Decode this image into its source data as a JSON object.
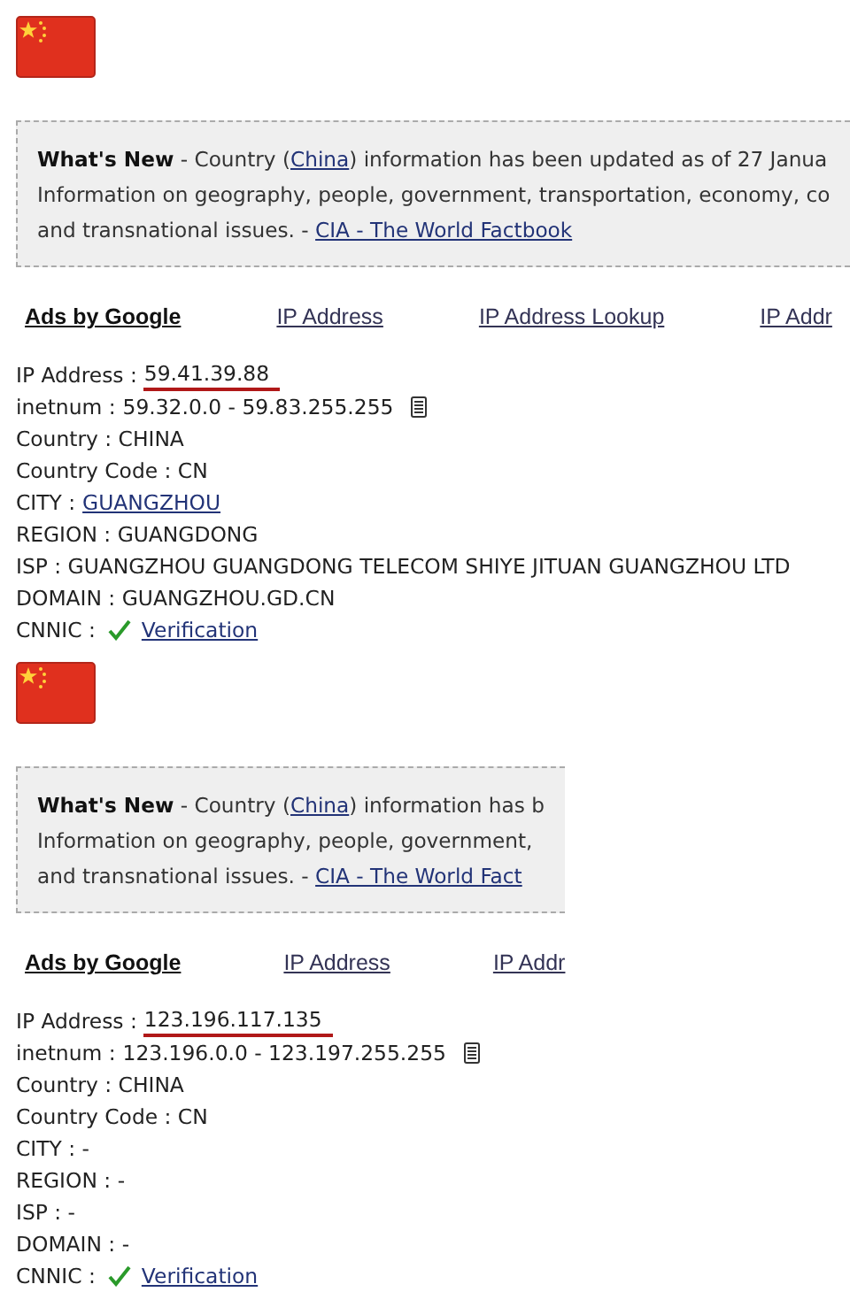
{
  "panels": [
    {
      "notice": {
        "lines": [
          [
            {
              "kind": "bold",
              "text": "What's New"
            },
            {
              "kind": "plain",
              "text": " - Country ("
            },
            {
              "kind": "link",
              "text": "China"
            },
            {
              "kind": "plain",
              "text": ") information has been updated as of 27 Janua"
            }
          ],
          [
            {
              "kind": "plain",
              "text": "Information on geography, people, government, transportation, economy, co"
            }
          ],
          [
            {
              "kind": "plain",
              "text": "and transnational issues. - "
            },
            {
              "kind": "link",
              "text": "CIA - The World Factbook"
            }
          ]
        ]
      },
      "ads": {
        "title": "Ads by Google",
        "links": [
          "IP Address",
          "IP Address Lookup",
          "IP Addr"
        ]
      },
      "fields": [
        {
          "kind": "highlight",
          "label": "IP Address :",
          "value": "59.41.39.88"
        },
        {
          "kind": "range",
          "label": "inetnum :",
          "value": "59.32.0.0 - 59.83.255.255"
        },
        {
          "kind": "text",
          "text": "Country : CHINA"
        },
        {
          "kind": "text",
          "text": "Country Code : CN"
        },
        {
          "kind": "link",
          "label": "CITY :",
          "value": "GUANGZHOU"
        },
        {
          "kind": "text",
          "text": "REGION : GUANGDONG"
        },
        {
          "kind": "text",
          "text": "ISP : GUANGZHOU GUANGDONG TELECOM SHIYE JITUAN GUANGZHOU LTD"
        },
        {
          "kind": "text",
          "text": "DOMAIN : GUANGZHOU.GD.CN"
        },
        {
          "kind": "verified",
          "label": "CNNIC :",
          "value": "Verification"
        }
      ]
    },
    {
      "notice": {
        "lines": [
          [
            {
              "kind": "bold",
              "text": "What's New"
            },
            {
              "kind": "plain",
              "text": " - Country ("
            },
            {
              "kind": "link",
              "text": "China"
            },
            {
              "kind": "plain",
              "text": ") information has b"
            }
          ],
          [
            {
              "kind": "plain",
              "text": "Information on geography, people, government,"
            }
          ],
          [
            {
              "kind": "plain",
              "text": "and transnational issues. - "
            },
            {
              "kind": "link",
              "text": "CIA - The World Fact"
            }
          ]
        ]
      },
      "ads": {
        "title": "Ads by Google",
        "links": [
          "IP Address",
          "IP Addr"
        ]
      },
      "fields": [
        {
          "kind": "highlight",
          "label": "IP Address :",
          "value": "123.196.117.135"
        },
        {
          "kind": "range",
          "label": "inetnum :",
          "value": "123.196.0.0 - 123.197.255.255"
        },
        {
          "kind": "text",
          "text": "Country : CHINA"
        },
        {
          "kind": "text",
          "text": "Country Code : CN"
        },
        {
          "kind": "text",
          "text": "CITY : -"
        },
        {
          "kind": "text",
          "text": "REGION : -"
        },
        {
          "kind": "text",
          "text": "ISP : -"
        },
        {
          "kind": "text",
          "text": "DOMAIN : -"
        },
        {
          "kind": "verified",
          "label": "CNNIC :",
          "value": "Verification"
        }
      ]
    }
  ]
}
